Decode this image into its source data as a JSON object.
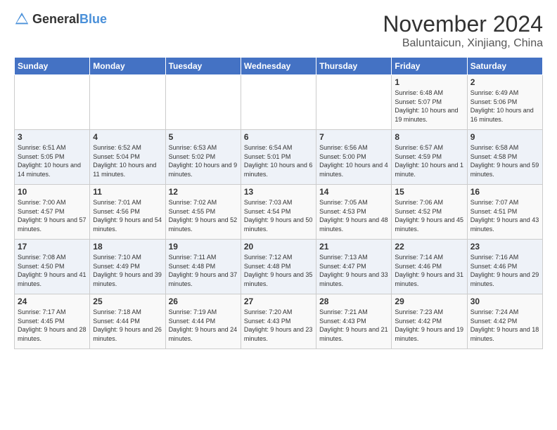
{
  "header": {
    "logo_general": "General",
    "logo_blue": "Blue",
    "title": "November 2024",
    "subtitle": "Baluntaicun, Xinjiang, China"
  },
  "weekdays": [
    "Sunday",
    "Monday",
    "Tuesday",
    "Wednesday",
    "Thursday",
    "Friday",
    "Saturday"
  ],
  "weeks": [
    [
      {
        "day": "",
        "info": ""
      },
      {
        "day": "",
        "info": ""
      },
      {
        "day": "",
        "info": ""
      },
      {
        "day": "",
        "info": ""
      },
      {
        "day": "",
        "info": ""
      },
      {
        "day": "1",
        "info": "Sunrise: 6:48 AM\nSunset: 5:07 PM\nDaylight: 10 hours and 19 minutes."
      },
      {
        "day": "2",
        "info": "Sunrise: 6:49 AM\nSunset: 5:06 PM\nDaylight: 10 hours and 16 minutes."
      }
    ],
    [
      {
        "day": "3",
        "info": "Sunrise: 6:51 AM\nSunset: 5:05 PM\nDaylight: 10 hours and 14 minutes."
      },
      {
        "day": "4",
        "info": "Sunrise: 6:52 AM\nSunset: 5:04 PM\nDaylight: 10 hours and 11 minutes."
      },
      {
        "day": "5",
        "info": "Sunrise: 6:53 AM\nSunset: 5:02 PM\nDaylight: 10 hours and 9 minutes."
      },
      {
        "day": "6",
        "info": "Sunrise: 6:54 AM\nSunset: 5:01 PM\nDaylight: 10 hours and 6 minutes."
      },
      {
        "day": "7",
        "info": "Sunrise: 6:56 AM\nSunset: 5:00 PM\nDaylight: 10 hours and 4 minutes."
      },
      {
        "day": "8",
        "info": "Sunrise: 6:57 AM\nSunset: 4:59 PM\nDaylight: 10 hours and 1 minute."
      },
      {
        "day": "9",
        "info": "Sunrise: 6:58 AM\nSunset: 4:58 PM\nDaylight: 9 hours and 59 minutes."
      }
    ],
    [
      {
        "day": "10",
        "info": "Sunrise: 7:00 AM\nSunset: 4:57 PM\nDaylight: 9 hours and 57 minutes."
      },
      {
        "day": "11",
        "info": "Sunrise: 7:01 AM\nSunset: 4:56 PM\nDaylight: 9 hours and 54 minutes."
      },
      {
        "day": "12",
        "info": "Sunrise: 7:02 AM\nSunset: 4:55 PM\nDaylight: 9 hours and 52 minutes."
      },
      {
        "day": "13",
        "info": "Sunrise: 7:03 AM\nSunset: 4:54 PM\nDaylight: 9 hours and 50 minutes."
      },
      {
        "day": "14",
        "info": "Sunrise: 7:05 AM\nSunset: 4:53 PM\nDaylight: 9 hours and 48 minutes."
      },
      {
        "day": "15",
        "info": "Sunrise: 7:06 AM\nSunset: 4:52 PM\nDaylight: 9 hours and 45 minutes."
      },
      {
        "day": "16",
        "info": "Sunrise: 7:07 AM\nSunset: 4:51 PM\nDaylight: 9 hours and 43 minutes."
      }
    ],
    [
      {
        "day": "17",
        "info": "Sunrise: 7:08 AM\nSunset: 4:50 PM\nDaylight: 9 hours and 41 minutes."
      },
      {
        "day": "18",
        "info": "Sunrise: 7:10 AM\nSunset: 4:49 PM\nDaylight: 9 hours and 39 minutes."
      },
      {
        "day": "19",
        "info": "Sunrise: 7:11 AM\nSunset: 4:48 PM\nDaylight: 9 hours and 37 minutes."
      },
      {
        "day": "20",
        "info": "Sunrise: 7:12 AM\nSunset: 4:48 PM\nDaylight: 9 hours and 35 minutes."
      },
      {
        "day": "21",
        "info": "Sunrise: 7:13 AM\nSunset: 4:47 PM\nDaylight: 9 hours and 33 minutes."
      },
      {
        "day": "22",
        "info": "Sunrise: 7:14 AM\nSunset: 4:46 PM\nDaylight: 9 hours and 31 minutes."
      },
      {
        "day": "23",
        "info": "Sunrise: 7:16 AM\nSunset: 4:46 PM\nDaylight: 9 hours and 29 minutes."
      }
    ],
    [
      {
        "day": "24",
        "info": "Sunrise: 7:17 AM\nSunset: 4:45 PM\nDaylight: 9 hours and 28 minutes."
      },
      {
        "day": "25",
        "info": "Sunrise: 7:18 AM\nSunset: 4:44 PM\nDaylight: 9 hours and 26 minutes."
      },
      {
        "day": "26",
        "info": "Sunrise: 7:19 AM\nSunset: 4:44 PM\nDaylight: 9 hours and 24 minutes."
      },
      {
        "day": "27",
        "info": "Sunrise: 7:20 AM\nSunset: 4:43 PM\nDaylight: 9 hours and 23 minutes."
      },
      {
        "day": "28",
        "info": "Sunrise: 7:21 AM\nSunset: 4:43 PM\nDaylight: 9 hours and 21 minutes."
      },
      {
        "day": "29",
        "info": "Sunrise: 7:23 AM\nSunset: 4:42 PM\nDaylight: 9 hours and 19 minutes."
      },
      {
        "day": "30",
        "info": "Sunrise: 7:24 AM\nSunset: 4:42 PM\nDaylight: 9 hours and 18 minutes."
      }
    ]
  ]
}
